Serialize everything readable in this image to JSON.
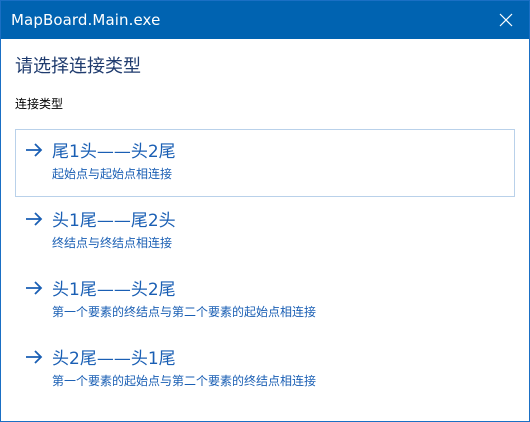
{
  "window": {
    "title": "MapBoard.Main.exe"
  },
  "dialog": {
    "heading": "请选择连接类型",
    "section_label": "连接类型"
  },
  "options": [
    {
      "title": "尾1头——头2尾",
      "description": "起始点与起始点相连接",
      "selected": true
    },
    {
      "title": "头1尾——尾2头",
      "description": "终结点与终结点相连接",
      "selected": false
    },
    {
      "title": "头1尾——头2尾",
      "description": "第一个要素的终结点与第二个要素的起始点相连接",
      "selected": false
    },
    {
      "title": "头2尾——头1尾",
      "description": "第一个要素的起始点与第二个要素的终结点相连接",
      "selected": false
    }
  ],
  "icons": {
    "close": "close-icon",
    "option_arrow": "arrow-right-icon"
  },
  "colors": {
    "titlebar": "#0063b1",
    "accent": "#1a5fb4",
    "heading": "#1f3b6e",
    "selected_border": "#b9d1ea"
  }
}
